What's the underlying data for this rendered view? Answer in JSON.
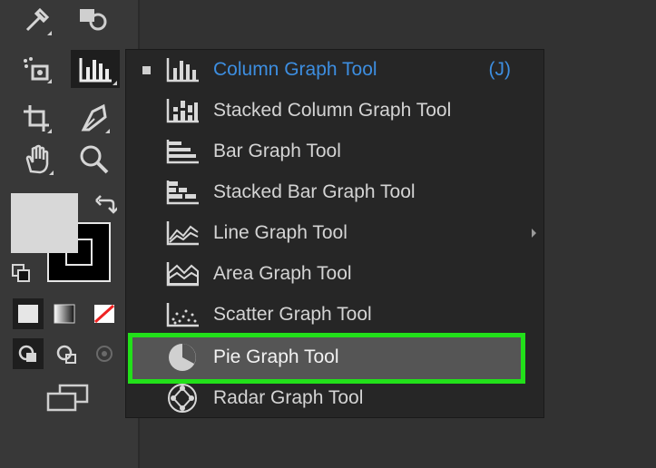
{
  "menu": {
    "items": [
      {
        "label": "Column Graph Tool",
        "shortcut": "(J)",
        "icon": "column-graph-icon"
      },
      {
        "label": "Stacked Column Graph Tool",
        "icon": "stacked-column-graph-icon"
      },
      {
        "label": "Bar Graph Tool",
        "icon": "bar-graph-icon"
      },
      {
        "label": "Stacked Bar Graph Tool",
        "icon": "stacked-bar-graph-icon"
      },
      {
        "label": "Line Graph Tool",
        "icon": "line-graph-icon"
      },
      {
        "label": "Area Graph Tool",
        "icon": "area-graph-icon"
      },
      {
        "label": "Scatter Graph Tool",
        "icon": "scatter-graph-icon"
      },
      {
        "label": "Pie Graph Tool",
        "icon": "pie-graph-icon"
      },
      {
        "label": "Radar Graph Tool",
        "icon": "radar-graph-icon"
      }
    ],
    "active_item": "Column Graph Tool",
    "highlighted_item": "Pie Graph Tool"
  },
  "colors": {
    "active_text": "#3d8ee0",
    "highlight_border": "#22e01a",
    "menu_bg": "#262626",
    "toolbar_bg": "#383838",
    "fill_swatch": "#d8d8d8"
  },
  "toolbar": {
    "tools": [
      "eyedropper-icon",
      "shape-builder-icon",
      "symbol-sprayer-icon",
      "column-graph-icon",
      "artboard-icon",
      "pen-icon",
      "hand-icon",
      "zoom-icon"
    ]
  }
}
